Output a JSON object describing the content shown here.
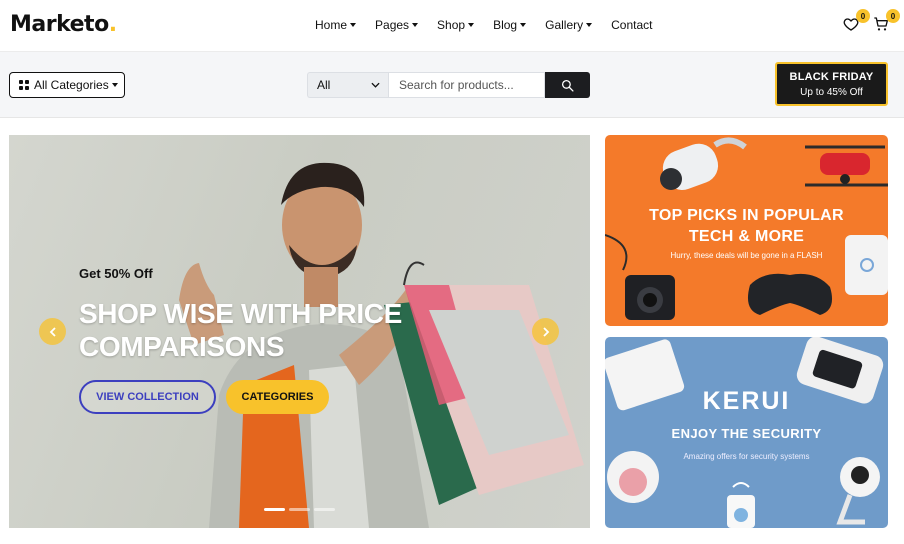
{
  "brand": {
    "logo_text": "Marketo",
    "logo_dot": "."
  },
  "nav": [
    {
      "label": "Home",
      "has_dropdown": true
    },
    {
      "label": "Pages",
      "has_dropdown": true
    },
    {
      "label": "Shop",
      "has_dropdown": true
    },
    {
      "label": "Blog",
      "has_dropdown": true
    },
    {
      "label": "Gallery",
      "has_dropdown": true
    },
    {
      "label": "Contact",
      "has_dropdown": false
    }
  ],
  "header_icons": {
    "wishlist_count": "0",
    "cart_count": "0",
    "wishlist_icon": "heart-icon",
    "cart_icon": "cart-icon"
  },
  "category_button": {
    "label": "All Categories",
    "icon": "grid-icon"
  },
  "search": {
    "scope_value": "All",
    "placeholder": "Search for products...",
    "button_icon": "search-icon"
  },
  "promo": {
    "title": "BLACK FRIDAY",
    "subtitle": "Up to 45% Off"
  },
  "hero": {
    "eyebrow": "Get 50% Off",
    "title": "SHOP WISE WITH PRICE COMPARISONS",
    "primary_button": "VIEW COLLECTION",
    "secondary_button": "CATEGORIES",
    "slide_count": 3,
    "active_slide": 1
  },
  "banner_tech": {
    "title_line1": "TOP PICKS IN POPULAR",
    "title_line2": "TECH & MORE",
    "subtitle": "Hurry, these deals will be gone in a FLASH"
  },
  "banner_security": {
    "brand": "KERUI",
    "title": "ENJOY THE SECURITY",
    "subtitle": "Amazing offers for security systems"
  },
  "colors": {
    "accent": "#f8c22b",
    "dark": "#1c1d20",
    "outline_button": "#3c3fbf",
    "banner_orange": "#f47a2a",
    "banner_blue": "#6f9bc9"
  }
}
